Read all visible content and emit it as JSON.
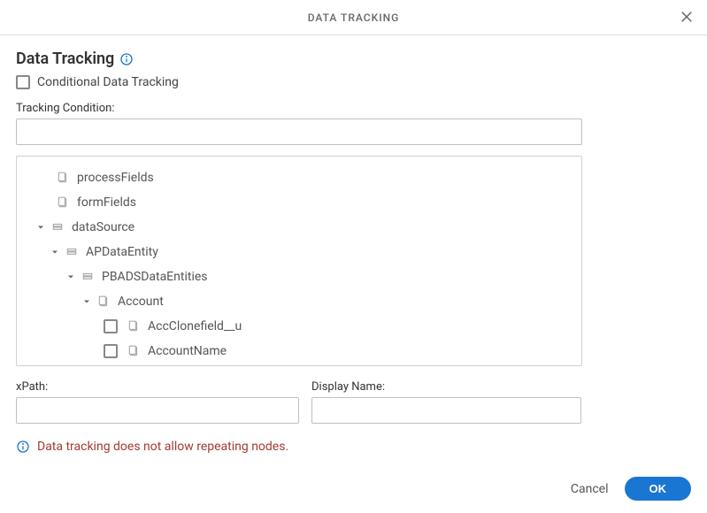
{
  "dialog": {
    "title": "DATA TRACKING"
  },
  "section": {
    "title": "Data Tracking"
  },
  "conditional": {
    "label": "Conditional Data Tracking"
  },
  "tracking_condition": {
    "label": "Tracking Condition:",
    "value": ""
  },
  "tree": {
    "n0": {
      "label": "processFields"
    },
    "n1": {
      "label": "formFields"
    },
    "n2": {
      "label": "dataSource"
    },
    "n3": {
      "label": "APDataEntity"
    },
    "n4": {
      "label": "PBADSDataEntities"
    },
    "n5": {
      "label": "Account"
    },
    "n6": {
      "label": "AccClonefield__u"
    },
    "n7": {
      "label": "AccountName"
    }
  },
  "xpath": {
    "label": "xPath:",
    "value": ""
  },
  "display_name": {
    "label": "Display Name:",
    "value": ""
  },
  "warning": {
    "text": "Data tracking does not allow repeating nodes."
  },
  "footer": {
    "cancel": "Cancel",
    "ok": "OK"
  }
}
